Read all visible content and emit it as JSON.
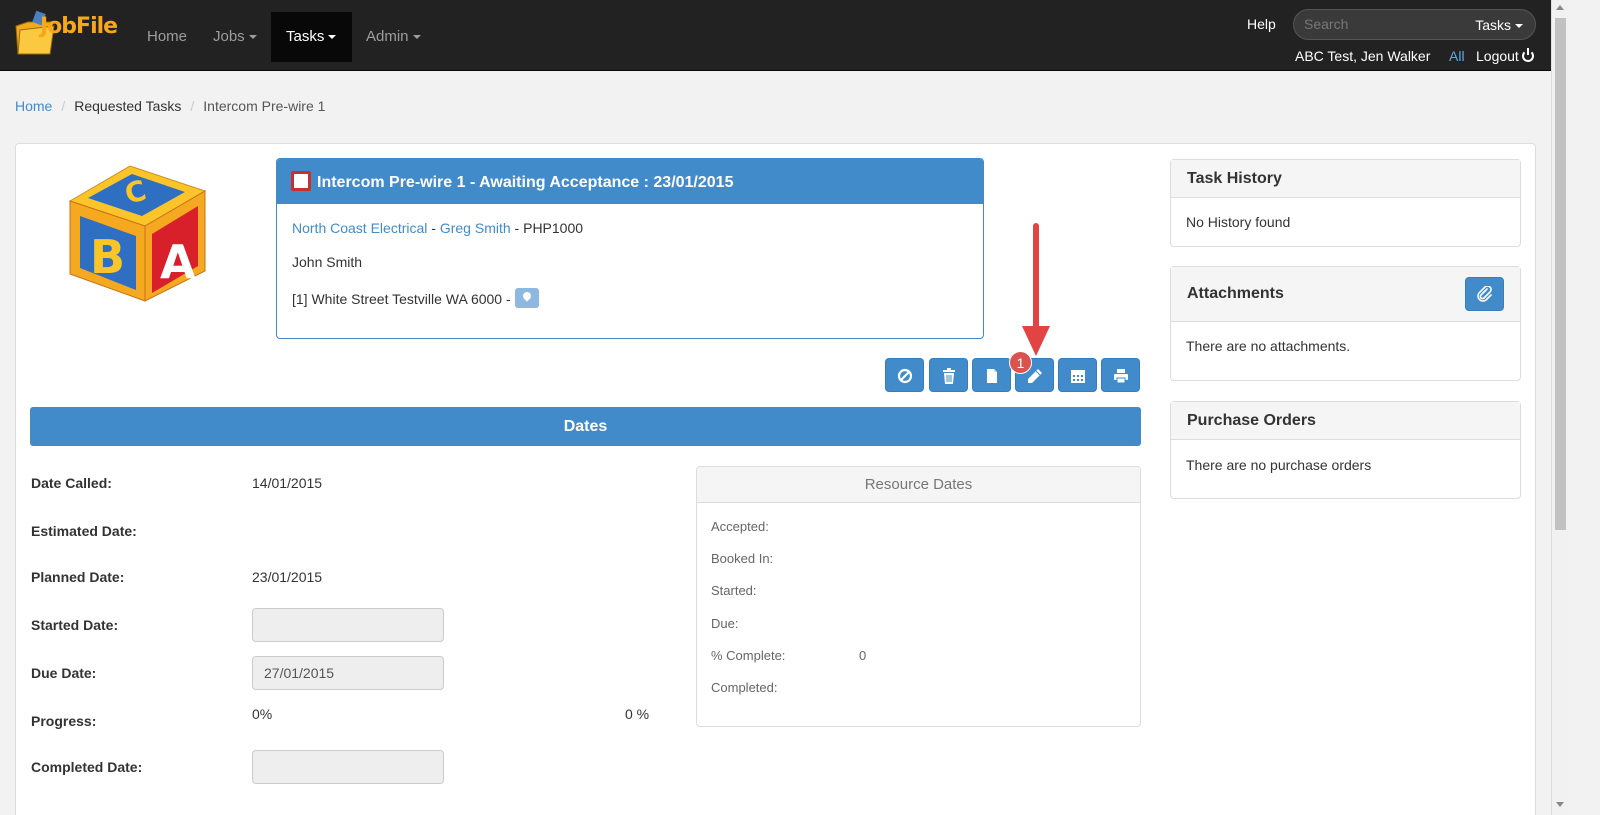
{
  "app": {
    "logo_text": "JobFile"
  },
  "nav": {
    "home": "Home",
    "jobs": "Jobs",
    "tasks": "Tasks",
    "admin": "Admin",
    "help": "Help",
    "search_placeholder": "Search",
    "search_scope": "Tasks",
    "user": "ABC Test, Jen Walker",
    "all": "All",
    "logout": "Logout"
  },
  "breadcrumb": [
    "Home",
    "Requested Tasks",
    "Intercom Pre-wire 1"
  ],
  "task": {
    "title": "Intercom Pre-wire 1 - Awaiting Acceptance : 23/01/2015",
    "company": "North Coast Electrical",
    "contact": "Greg Smith",
    "job_code": "PHP1000",
    "customer": "John Smith",
    "address": "[1] White Street Testville WA 6000 -",
    "separator": "-"
  },
  "toolbar": {
    "buttons": [
      "cancel-icon",
      "trash-icon",
      "document-icon",
      "pencil-icon",
      "calendar-icon",
      "print-icon"
    ],
    "badge": "1"
  },
  "dates": {
    "header": "Dates",
    "date_called_label": "Date Called:",
    "date_called": "14/01/2015",
    "estimated_label": "Estimated Date:",
    "estimated": "",
    "planned_label": "Planned Date:",
    "planned": "23/01/2015",
    "started_label": "Started Date:",
    "started": "",
    "due_label": "Due Date:",
    "due": "27/01/2015",
    "progress_label": "Progress:",
    "progress": "0%",
    "progress_pct": "0 %",
    "completed_label": "Completed Date:",
    "completed": ""
  },
  "resource_dates": {
    "header": "Resource Dates",
    "accepted_label": "Accepted:",
    "booked_label": "Booked In:",
    "started_label": "Started:",
    "due_label": "Due:",
    "complete_label": "% Complete:",
    "complete_value": "0",
    "completed_label": "Completed:"
  },
  "task_history": {
    "title": "Task History",
    "empty": "No History found"
  },
  "attachments": {
    "title": "Attachments",
    "empty": "There are no attachments."
  },
  "purchase_orders": {
    "title": "Purchase Orders",
    "empty": "There are no purchase orders"
  },
  "colors": {
    "primary": "#428bca",
    "navbar": "#222222",
    "badge": "#d9534f",
    "arrow": "#e24444"
  }
}
